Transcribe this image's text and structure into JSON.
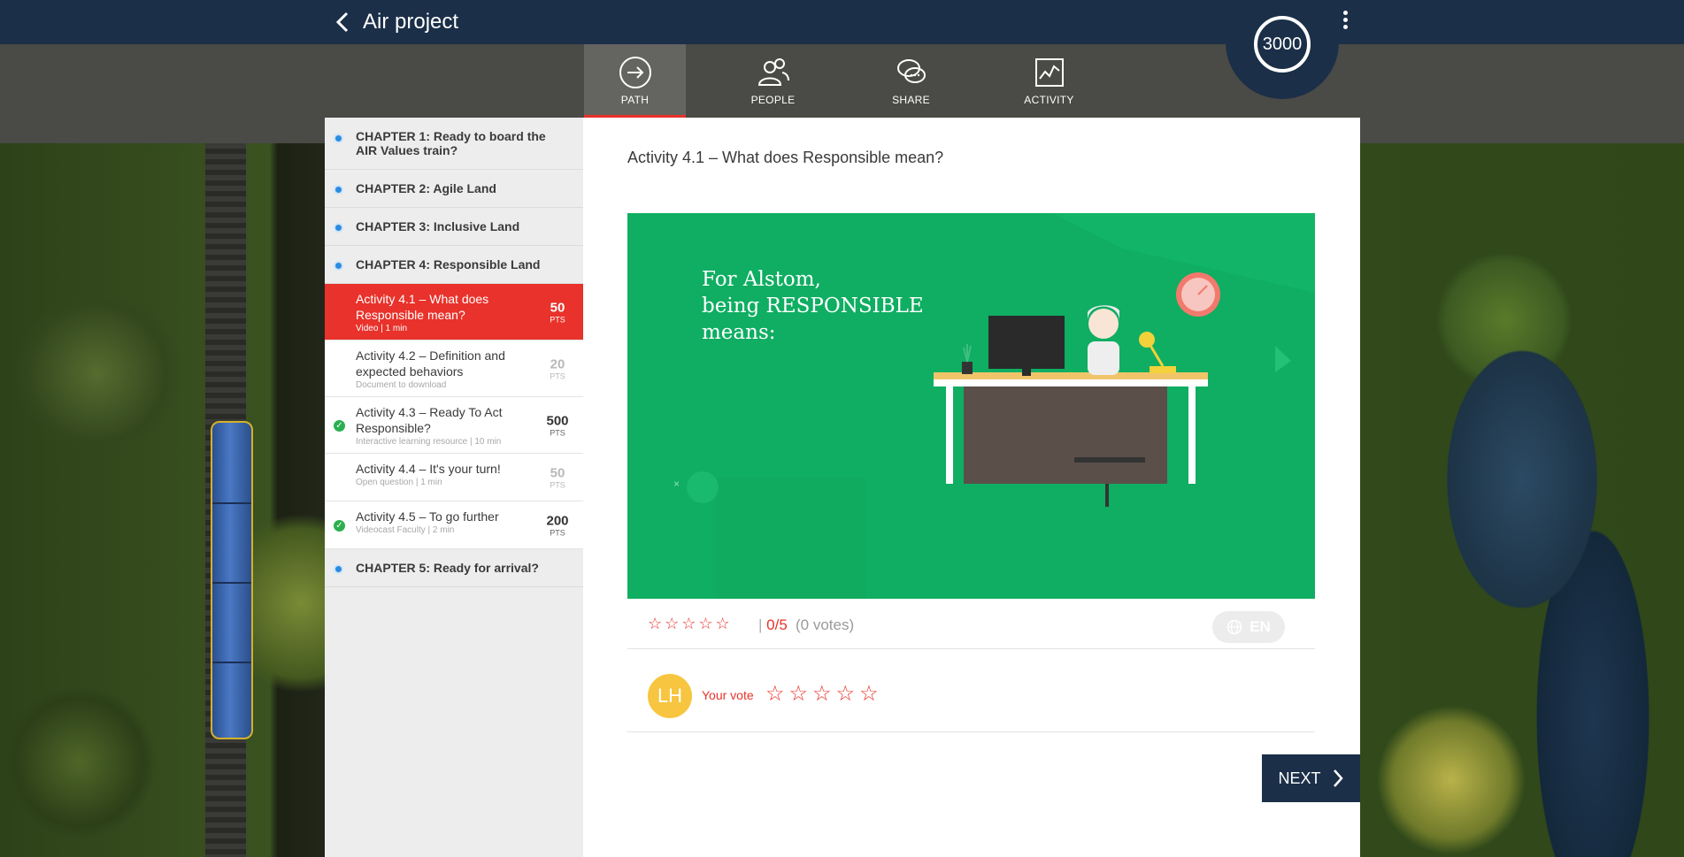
{
  "header": {
    "back_icon": "chevron-left-icon",
    "title": "Air project",
    "points": "3000",
    "menu_icon": "kebab-menu-icon"
  },
  "nav": {
    "tabs": [
      {
        "label": "PATH",
        "icon": "arrow-circle-icon",
        "active": true
      },
      {
        "label": "PEOPLE",
        "icon": "people-icon",
        "active": false
      },
      {
        "label": "SHARE",
        "icon": "chat-bubbles-icon",
        "active": false
      },
      {
        "label": "ACTIVITY",
        "icon": "activity-chart-icon",
        "active": false
      }
    ]
  },
  "sidebar": {
    "chapters": [
      {
        "label": "CHAPTER 1: Ready to board the AIR Values train?"
      },
      {
        "label": "CHAPTER 2: Agile Land"
      },
      {
        "label": "CHAPTER 3: Inclusive Land"
      },
      {
        "label": "CHAPTER 4: Responsible Land"
      },
      {
        "label": "CHAPTER 5: Ready for arrival?"
      }
    ],
    "activities": [
      {
        "title": "Activity 4.1 – What does Responsible mean?",
        "subtitle": "Video | 1 min",
        "points": "50",
        "unit": "PTS",
        "state": "active"
      },
      {
        "title": "Activity 4.2 – Definition and expected behaviors",
        "subtitle": "Document to download",
        "points": "20",
        "unit": "PTS",
        "state": "todo"
      },
      {
        "title": "Activity 4.3 – Ready To Act Responsible?",
        "subtitle": "Interactive learning resource | 10 min",
        "points": "500",
        "unit": "PTS",
        "state": "done"
      },
      {
        "title": "Activity 4.4 – It's your turn!",
        "subtitle": "Open question | 1 min",
        "points": "50",
        "unit": "PTS",
        "state": "todo"
      },
      {
        "title": "Activity 4.5 – To go further",
        "subtitle": "Videocast Faculty | 2 min",
        "points": "200",
        "unit": "PTS",
        "state": "done"
      }
    ]
  },
  "main": {
    "title": "Activity 4.1 – What does Responsible mean?",
    "video_caption": "For Alstom,\nbeing RESPONSIBLE\nmeans:",
    "rating": {
      "stars": "☆☆☆☆☆",
      "score": "0/5",
      "votes": "(0 votes)"
    },
    "language": {
      "icon": "globe-icon",
      "label": "EN"
    },
    "vote": {
      "avatar_initials": "LH",
      "label": "Your vote",
      "stars": "☆☆☆☆☆"
    },
    "next_label": "NEXT"
  },
  "colors": {
    "header_bg": "#1b2f48",
    "accent_red": "#e8322b",
    "video_green": "#0fae62",
    "done_green": "#2cb04f",
    "avatar_yellow": "#f7c540"
  }
}
